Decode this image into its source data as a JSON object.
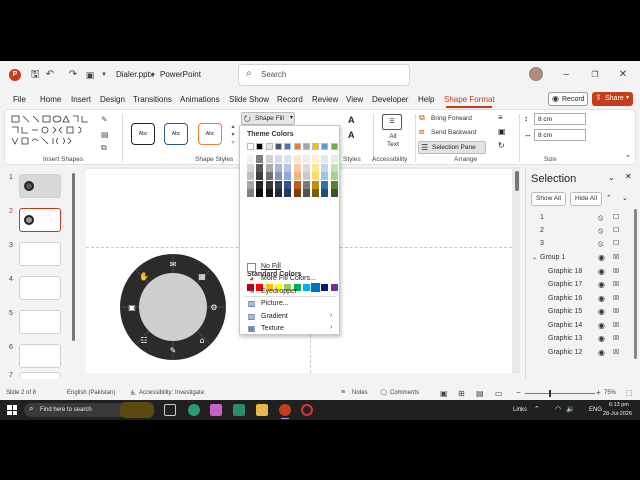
{
  "titlebar": {
    "filename": "Dialer.pptx",
    "separator": "•",
    "app": "PowerPoint",
    "search_placeholder": "Search",
    "autosave_icon": "save-icon",
    "undo_icon": "undo-icon",
    "redo_icon": "redo-icon"
  },
  "menu": {
    "tabs": [
      "File",
      "Home",
      "Insert",
      "Design",
      "Transitions",
      "Animations",
      "Slide Show",
      "Record",
      "Review",
      "View",
      "Developer",
      "Help",
      "Shape Format"
    ],
    "active": "Shape Format",
    "record_label": "Record",
    "share_label": "Share"
  },
  "ribbon": {
    "groups": {
      "insert_shapes": "Insert Shapes",
      "shape_styles": "Shape Styles",
      "wordart_styles": "Styles",
      "accessibility": "Accessibility",
      "arrange": "Arrange",
      "size": "Size"
    },
    "style_sample": "Abc",
    "shape_fill_label": "Shape Fill",
    "alt_text_label": "Alt Text",
    "bring_forward": "Bring Forward",
    "send_backward": "Send Backward",
    "selection_pane": "Selection Pane",
    "height": "8 cm",
    "width": "8 cm",
    "accent": "#c43e1c"
  },
  "fill_dropdown": {
    "theme_colors_label": "Theme Colors",
    "standard_colors_label": "Standard Colors",
    "theme_top_row": [
      "#ffffff",
      "#000000",
      "#e7e6e6",
      "#44546a",
      "#4472c4",
      "#ed7d31",
      "#a5a5a5",
      "#ffc000",
      "#5b9bd5",
      "#70ad47"
    ],
    "theme_shades": [
      [
        "#f2f2f2",
        "#7f7f7f",
        "#d0cece",
        "#d6dce4",
        "#d9e2f3",
        "#fbe5d5",
        "#ededed",
        "#fff2cc",
        "#deebf6",
        "#e2efd9"
      ],
      [
        "#d8d8d8",
        "#595959",
        "#aeabab",
        "#adb9ca",
        "#b4c6e7",
        "#f7cbac",
        "#dbdbdb",
        "#fee599",
        "#bdd7ee",
        "#c5e0b3"
      ],
      [
        "#bfbfbf",
        "#3f3f3f",
        "#757070",
        "#8496b0",
        "#8eaadb",
        "#f4b183",
        "#c9c9c9",
        "#ffd965",
        "#9dc3e6",
        "#a8d08d"
      ],
      [
        "#a5a5a5",
        "#262626",
        "#3a3838",
        "#323f4f",
        "#2f5496",
        "#c55a11",
        "#7b7b7b",
        "#bf9000",
        "#2e75b5",
        "#538135"
      ],
      [
        "#7f7f7f",
        "#0c0c0c",
        "#171616",
        "#222a35",
        "#1f3864",
        "#833c0b",
        "#525252",
        "#7f6000",
        "#1e4e79",
        "#375623"
      ]
    ],
    "standard": [
      "#c00000",
      "#ff0000",
      "#ffc000",
      "#ffff00",
      "#92d050",
      "#00b050",
      "#00b0f0",
      "#0070c0",
      "#002060",
      "#7030a0"
    ],
    "items": [
      {
        "label": "No Fill",
        "icon": "no-fill-icon",
        "submenu": false
      },
      {
        "label": "More Fill Colors...",
        "icon": "palette-icon",
        "submenu": false
      },
      {
        "label": "Eyedropper",
        "icon": "eyedropper-icon",
        "submenu": false
      },
      {
        "label": "Picture...",
        "icon": "picture-icon",
        "submenu": false
      },
      {
        "label": "Gradient",
        "icon": "gradient-icon",
        "submenu": true
      },
      {
        "label": "Texture",
        "icon": "texture-icon",
        "submenu": true
      }
    ]
  },
  "slides": {
    "numbers": [
      "1",
      "2",
      "3",
      "4",
      "5",
      "6",
      "7"
    ],
    "selected": 2
  },
  "selection_pane": {
    "title": "Selection",
    "show_all": "Show All",
    "hide_all": "Hide All",
    "rows": [
      {
        "name": "1",
        "indent": 0,
        "lock": "unlocked"
      },
      {
        "name": "2",
        "indent": 0,
        "lock": "unlocked"
      },
      {
        "name": "3",
        "indent": 0,
        "lock": "unlocked"
      },
      {
        "name": "Group 1",
        "indent": 0,
        "group": true,
        "lock": "locked"
      },
      {
        "name": "Graphic 18",
        "indent": 1,
        "lock": "locked"
      },
      {
        "name": "Graphic 17",
        "indent": 1,
        "lock": "locked"
      },
      {
        "name": "Graphic 16",
        "indent": 1,
        "lock": "locked"
      },
      {
        "name": "Graphic 15",
        "indent": 1,
        "lock": "locked"
      },
      {
        "name": "Graphic 14",
        "indent": 1,
        "lock": "locked"
      },
      {
        "name": "Graphic 13",
        "indent": 1,
        "lock": "locked"
      },
      {
        "name": "Graphic 12",
        "indent": 1,
        "lock": "locked"
      }
    ]
  },
  "statusbar": {
    "slide_info": "Slide 2 of 8",
    "language": "English (Pakistan)",
    "accessibility": "Accessibility: Investigate",
    "notes": "Notes",
    "comments": "Comments",
    "zoom": "75%"
  },
  "taskbar": {
    "search_placeholder": "Find here to search",
    "links": "Links",
    "lang": "ENG",
    "time": "6:13 pm",
    "date": "28-Jul-2026"
  }
}
